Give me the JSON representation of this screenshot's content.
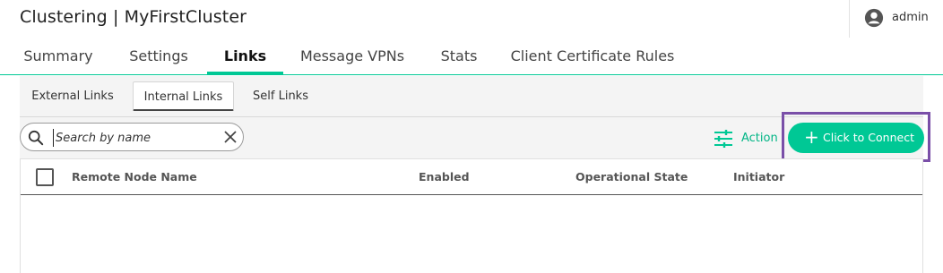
{
  "window": {
    "title": "Clustering | MyFirstCluster"
  },
  "user": {
    "name": "admin",
    "icon": "account-circle-icon"
  },
  "tabs": [
    {
      "label": "Summary",
      "active": false
    },
    {
      "label": "Settings",
      "active": false
    },
    {
      "label": "Links",
      "active": true
    },
    {
      "label": "Message VPNs",
      "active": false
    },
    {
      "label": "Stats",
      "active": false
    },
    {
      "label": "Client Certificate Rules",
      "active": false
    }
  ],
  "subtabs": [
    {
      "label": "External Links",
      "active": false
    },
    {
      "label": "Internal Links",
      "active": true
    },
    {
      "label": "Self Links",
      "active": false
    }
  ],
  "search": {
    "placeholder": "Search by name",
    "value": ""
  },
  "toolbar": {
    "action_label": "Action",
    "connect_label": "Click to Connect"
  },
  "table": {
    "columns": [
      "Remote Node Name",
      "Enabled",
      "Operational State",
      "Initiator"
    ],
    "rows": []
  },
  "colors": {
    "accent": "#00c895",
    "highlight": "#7a4fa8"
  }
}
